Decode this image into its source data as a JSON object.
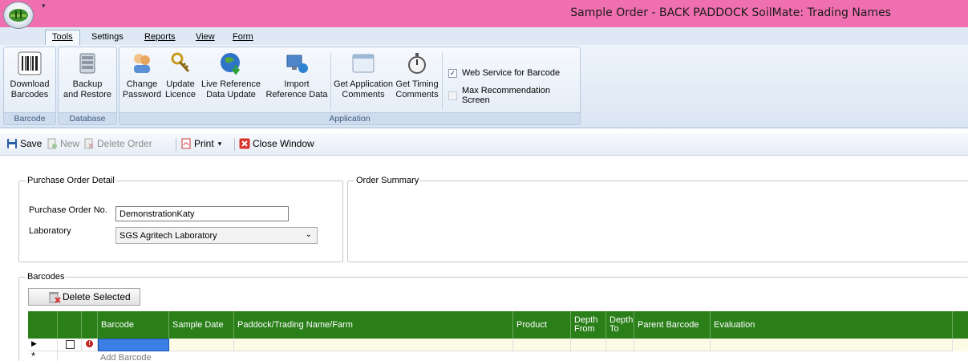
{
  "window": {
    "title": "Sample Order - BACK PADDOCK SoilMate: Trading Names"
  },
  "ribbon_tabs": [
    {
      "label": "Tools",
      "active": true
    },
    {
      "label": "Settings",
      "active": false
    },
    {
      "label": "Reports",
      "active": false
    },
    {
      "label": "View",
      "active": false
    },
    {
      "label": "Form",
      "active": false
    }
  ],
  "ribbon": {
    "groups": {
      "barcode": "Barcode",
      "database": "Database",
      "application": "Application"
    },
    "buttons": {
      "download_barcodes": [
        "Download",
        "Barcodes"
      ],
      "backup_restore": [
        "Backup",
        "and Restore"
      ],
      "change_password": [
        "Change",
        "Password"
      ],
      "update_licence": [
        "Update",
        "Licence"
      ],
      "live_reference": [
        "Live Reference",
        "Data Update"
      ],
      "import_reference": [
        "Import",
        "Reference Data"
      ],
      "get_app_comments": [
        "Get Application",
        "Comments"
      ],
      "get_timing_comments": [
        "Get Timing",
        "Comments"
      ]
    },
    "checkboxes": {
      "web_service": {
        "label": "Web Service for Barcode",
        "checked": true
      },
      "max_recommendation": {
        "label": "Max Recommendation Screen",
        "checked": false
      }
    }
  },
  "toolbar": {
    "save": "Save",
    "new": "New",
    "delete_order": "Delete Order",
    "print": "Print",
    "close_window": "Close Window"
  },
  "purchase_order": {
    "legend": "Purchase Order Detail",
    "po_label": "Purchase Order No.",
    "po_value": "DemonstrationKaty",
    "lab_label": "Laboratory",
    "lab_value": "SGS Agritech Laboratory"
  },
  "order_summary": {
    "legend": "Order Summary"
  },
  "barcodes": {
    "legend": "Barcodes",
    "delete_selected": "Delete Selected",
    "columns": {
      "barcode": "Barcode",
      "sample_date": "Sample Date",
      "paddock": "Paddock/Trading Name/Farm",
      "product": "Product",
      "depth_from": [
        "Depth",
        "From"
      ],
      "depth_to": [
        "Depth",
        "To"
      ],
      "parent_barcode": "Parent Barcode",
      "evaluation": "Evaluation"
    },
    "new_row_hint": "Add Barcode"
  },
  "colors": {
    "title_bar": "#f06fb0",
    "grid_header": "#2a7f19",
    "row_highlight": "#fbfbe6",
    "selected_cell": "#3a7ee6"
  }
}
